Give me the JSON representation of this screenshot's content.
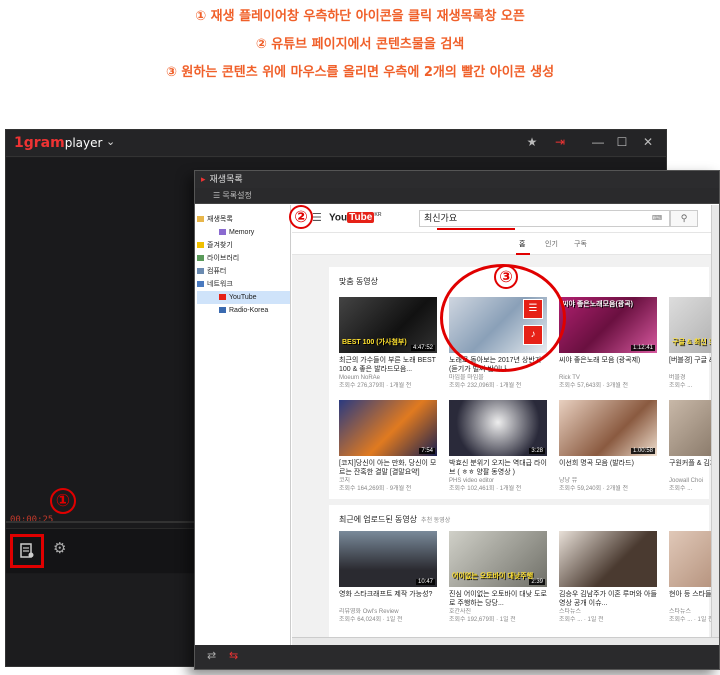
{
  "instructions": [
    "① 재생 플레이어창 우측하단 아이콘을 클릭 재생목록창 오픈",
    "② 유튜브 페이지에서 콘텐츠물을 검색",
    "③ 원하는 콘텐츠 위에 마우스를 올리면 우측에 2개의 빨간 아이콘 생성"
  ],
  "player": {
    "logo_num": "1gram",
    "logo_text": "player",
    "time": "00:00:25",
    "playlist_icon": "playlist-icon",
    "settings_icon": "gear-icon",
    "accent": "#e00000"
  },
  "callouts": {
    "one": "①",
    "two": "②",
    "three": "③"
  },
  "playlist_window": {
    "title": "재생목록",
    "settings_label": "목록설정",
    "tree": [
      {
        "label": "재생목록",
        "level": 0
      },
      {
        "label": "Memory",
        "level": 1
      },
      {
        "label": "즐겨찾기",
        "level": 0
      },
      {
        "label": "라이브러리",
        "level": 0
      },
      {
        "label": "컴퓨터",
        "level": 0
      },
      {
        "label": "네트워크",
        "level": 0
      },
      {
        "label": "YouTube",
        "level": 1,
        "selected": true
      },
      {
        "label": "Radio-Korea",
        "level": 1
      }
    ]
  },
  "youtube": {
    "logo_you": "You",
    "logo_tube": "Tube",
    "logo_region": "KR",
    "search_value": "최신가요",
    "tabs": [
      "홈",
      "인기",
      "구독"
    ],
    "section1_title": "맞춤 동영상",
    "section2_title": "최근에 업로드된 동영상",
    "section2_sub": "추천 동영상",
    "row1": [
      {
        "title": "최근의 가수들이 부른 노래 BEST 100 & 좋은 발라드모음...",
        "channel": "Moeum NoRAe",
        "meta": "조회수 276,379회 · 1개월 전",
        "dur": "4:47:52",
        "overlay": "BEST 100 (가사첨부)"
      },
      {
        "title": "노래로 돌아보는 2017년 상반기 (듣기가 벌써 반이나...",
        "channel": "마임블 마임블",
        "meta": "조회수 232,096회 · 1개월 전",
        "dur": "",
        "overlay": ""
      },
      {
        "title": "씨야 좋은노래 모음 (광곡제)",
        "channel": "Rick TV",
        "meta": "조회수 57,643회 · 3개월 전",
        "dur": "1:12:41",
        "overlay": "씨야 좋은노래모음(광곡)"
      },
      {
        "title": "[버블경] 구글 & 최신 노래...",
        "channel": "버블경",
        "meta": "조회수 ...",
        "dur": "",
        "overlay": "구글 & 최신 노래"
      }
    ],
    "row2": [
      {
        "title": "[코지]당신이 아는 만화, 당신이 모르는 잔혹한 결말 [결말요약]",
        "channel": "코지",
        "meta": "조회수 164,269회 · 9개월 전",
        "dur": "7:54",
        "overlay": ""
      },
      {
        "title": "박효신 분위기 오지는 역대급 라이브 ( ㅎㅎ 양팔 동영상 )",
        "channel": "PHS video editor",
        "meta": "조회수 102,461회 · 1개월 전",
        "dur": "3:28",
        "overlay": ""
      },
      {
        "title": "이선희 명곡 모음 (발라드)",
        "channel": "냥냥 뮤",
        "meta": "조회수 59,240회 · 2개월 전",
        "dur": "1:00:58",
        "overlay": ""
      },
      {
        "title": "구원커플 & 김지원 Eng s...",
        "channel": "Joowall Choi",
        "meta": "조회수 ...",
        "dur": "",
        "overlay": ""
      }
    ],
    "row3": [
      {
        "title": "영화 스타크래프트 제작 가능성?",
        "channel": "리뷰영화 Owl's Review",
        "meta": "조회수 64,024회 · 1일 전",
        "dur": "10:47",
        "overlay": ""
      },
      {
        "title": "진심 어이없는 오토바이 대낮 도로로 주행하는 당당...",
        "channel": "호간사진",
        "meta": "조회수 192,679회 · 1일 전",
        "dur": "2:39",
        "overlay": "어이없는 오토바이 대낮주행"
      },
      {
        "title": "김승우 김남주가 이혼 루머와 아들 영상 공개 이슈...",
        "channel": "스타뉴스",
        "meta": "조회수 ... · 1일 전",
        "dur": "",
        "overlay": ""
      },
      {
        "title": "현아 등 스타들의 빌보드 ...",
        "channel": "스타뉴스",
        "meta": "조회수 ... · 1일 전",
        "dur": "",
        "overlay": ""
      }
    ]
  },
  "hover_icons": [
    "playlist-add-icon",
    "music-note-icon"
  ],
  "colors": {
    "accent": "#e00000",
    "instruction": "#f0602a",
    "youtube_red": "#e62117"
  }
}
